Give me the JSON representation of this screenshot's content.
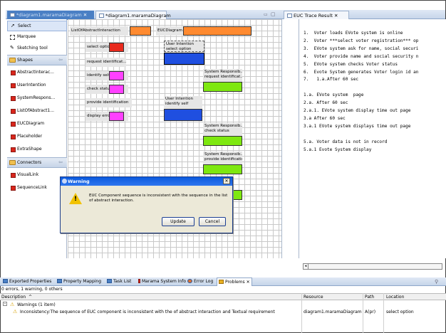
{
  "editor_tabs": [
    {
      "label": "*diagram1.maramaDiagram",
      "active": true
    },
    {
      "label": "*diagram1.maramaDiagram",
      "active": false
    }
  ],
  "palette": {
    "tools": [
      "Select",
      "Marquee",
      "Sketching tool"
    ],
    "shapes_header": "Shapes",
    "shapes": [
      "AbstractInterac...",
      "UserIntention",
      "SystemRespons...",
      "ListOfAbstract1...",
      "EUCDiagram",
      "Placeholder",
      "ExtraShape"
    ],
    "connectors_header": "Connectors",
    "connectors": [
      "VisualLink",
      "SequenceLink"
    ]
  },
  "canvas": {
    "header_left": "ListOfAbstractInteraction",
    "header_right": "EUCDiagram",
    "abstract_items": [
      "select option",
      "request identificat...",
      "identify self",
      "check status",
      "provide identification",
      "display error"
    ],
    "user_intentions": [
      {
        "line1": "User Intention",
        "line2": "select option"
      },
      {
        "line1": "User Intention",
        "line2": "identify self"
      }
    ],
    "system_responsibilities": [
      {
        "line1": "System Responsib...",
        "line2": "request identificat..."
      },
      {
        "line1": "System Responsib...",
        "line2": "check status"
      },
      {
        "line1": "System Responsib...",
        "line2": "provide identification"
      }
    ]
  },
  "dialog": {
    "title": "Warning",
    "message": "EUC Component sequence is inconsistent with the sequence in the list of abstract interaction.",
    "update_label": "Update",
    "cancel_label": "Cancel"
  },
  "trace": {
    "tab_label": "EUC Trace Result",
    "lines": [
      "1.  Voter loads EVote system is online",
      "2.  Voter ***select voter registration*** op",
      "3.  EVote system ask for name, social securi",
      "4.  Voter provide name and social security n",
      "5.  EVote system checks Voter status",
      "6.  Evote System generates Voter login id an",
      "7.   1.a.After 60 sec",
      "",
      "1.a. EVote system  page",
      "2.a. After 60 sec",
      "2.a.1. EVote system display time out page",
      "3.a After 60 sec",
      "3.a.1 EVote system displays time out page",
      "",
      "5.a. Voter data is not in record",
      "5.a.1 Evote System display"
    ]
  },
  "bottom_tabs": [
    "Exported Properties",
    "Property Mapping",
    "Task List",
    "Marama System Info",
    "Error Log",
    "Problems"
  ],
  "problems": {
    "summary": "0 errors, 1 warning, 0 others",
    "columns": [
      "Description",
      "Resource",
      "Path",
      "Location"
    ],
    "group_label": "Warnings (1 item)",
    "row": {
      "description": "Inconsistency:The sequence of EUC component is inconsistent with the of abstract interaction and Textual requirement",
      "resource": "diagram1.maramaDiagram",
      "path": "A(pr)",
      "location": "select option"
    }
  },
  "colors": {
    "abstract_interaction": "#e8291c",
    "identify_check": "#ff40ff",
    "user_intention": "#1f4fe0",
    "system_responsibility": "#7ee810",
    "header_box": "#ff8a30"
  }
}
